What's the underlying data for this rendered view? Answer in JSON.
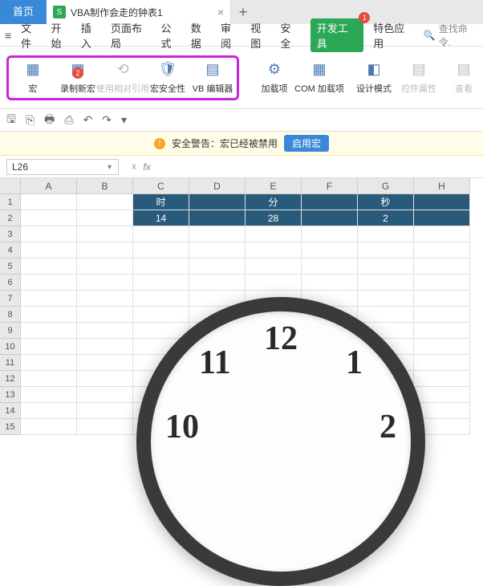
{
  "tabs": {
    "home": "首页",
    "file": "VBA制作会走的钟表1"
  },
  "menu": {
    "file": "文件",
    "start": "开始",
    "insert": "插入",
    "layout": "页面布局",
    "formula": "公式",
    "data": "数据",
    "review": "审阅",
    "view": "视图",
    "security": "安全",
    "dev": "开发工具",
    "special": "特色应用",
    "dev_badge": "1",
    "search": "查找命令."
  },
  "ribbon": {
    "macro": "宏",
    "record": "录制新宏",
    "record_badge": "2",
    "relative": "使用相对引用",
    "security": "宏安全性",
    "vb": "VB 编辑器",
    "addin": "加载项",
    "com": "COM 加载项",
    "design": "设计模式",
    "props": "控件属性",
    "view": "查看"
  },
  "warn": {
    "text": "安全警告：宏已经被禁用",
    "btn": "启用宏"
  },
  "namebox": "L26",
  "cols": [
    "A",
    "B",
    "C",
    "D",
    "E",
    "F",
    "G",
    "H"
  ],
  "rows": [
    "1",
    "2",
    "3",
    "4",
    "5",
    "6",
    "7",
    "8",
    "9",
    "10",
    "11",
    "12",
    "13",
    "14",
    "15"
  ],
  "headers": {
    "c": "时",
    "e": "分",
    "g": "秒"
  },
  "values": {
    "c": "14",
    "e": "28",
    "g": "2"
  },
  "clock": {
    "n12": "12",
    "n11": "11",
    "n1": "1",
    "n10": "10",
    "n2": "2"
  }
}
